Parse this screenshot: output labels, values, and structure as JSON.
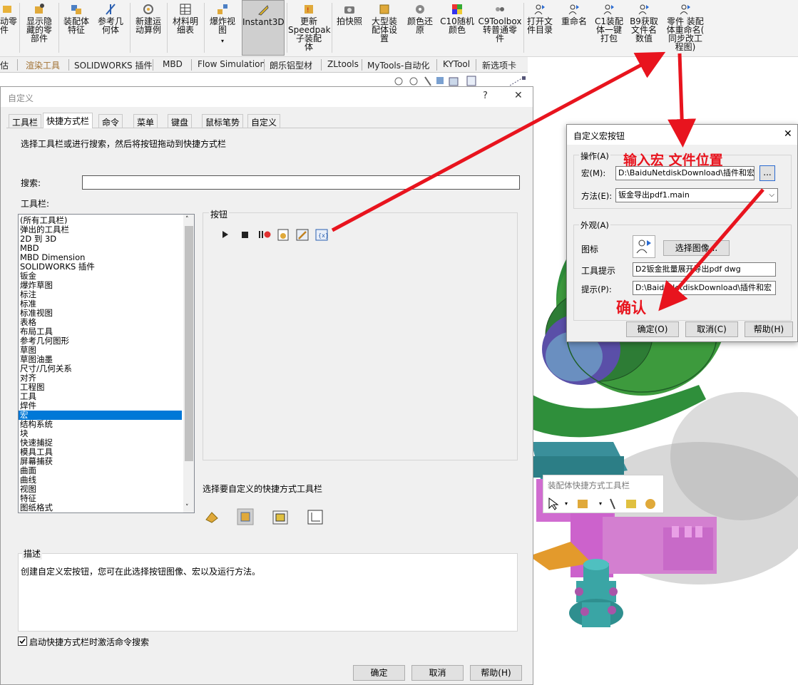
{
  "ribbon": {
    "items": [
      {
        "label": "动零\n件"
      },
      {
        "label": "显示隐\n藏的零\n部件"
      },
      {
        "label": "装配体\n特征"
      },
      {
        "label": "参考几\n何体"
      },
      {
        "label": "新建运\n动算例"
      },
      {
        "label": "材料明\n细表"
      },
      {
        "label": "爆炸视\n图"
      },
      {
        "label": "Instant3D"
      },
      {
        "label": "更新\nSpeedpak\n子装配\n体"
      },
      {
        "label": "拍快照"
      },
      {
        "label": "大型装\n配体设\n置"
      },
      {
        "label": "颜色还\n原"
      },
      {
        "label": "C10随机\n颜色"
      },
      {
        "label": "C9Toolbox\n转普通零\n件"
      },
      {
        "label": "打开文\n件目录"
      },
      {
        "label": "重命名"
      },
      {
        "label": "C1装配\n体一键\n打包"
      },
      {
        "label": "B9获取\n文件名\n数值"
      },
      {
        "label": "零件 装配\n体重命名(\n同步改工\n程图)"
      }
    ]
  },
  "cmdtabs": [
    "估",
    "渲染工具",
    "SOLIDWORKS 插件",
    "MBD",
    "Flow Simulation",
    "朗乐铝型材",
    "ZLtools",
    "MyTools-自动化",
    "KYTool",
    "新选项卡"
  ],
  "dialog": {
    "title": "自定义",
    "help": "?",
    "close": "✕",
    "tabs": [
      "工具栏",
      "快捷方式栏",
      "命令",
      "菜单",
      "键盘",
      "鼠标笔势",
      "自定义"
    ],
    "instruction": "选择工具栏或进行搜索，然后将按钮拖动到快捷方式栏",
    "search_label": "搜索:",
    "search_value": "",
    "toolbar_label": "工具栏:",
    "toolbars": [
      "(所有工具栏)",
      "弹出的工具栏",
      "2D 到 3D",
      "MBD",
      "MBD Dimension",
      "SOLIDWORKS 插件",
      "钣金",
      "爆炸草图",
      "标注",
      "标准",
      "标准视图",
      "表格",
      "布局工具",
      "参考几何图形",
      "草图",
      "草图油墨",
      "尺寸/几何关系",
      "对齐",
      "工程图",
      "工具",
      "焊件",
      "宏",
      "结构系统",
      "块",
      "快速捕捉",
      "模具工具",
      "屏幕捕获",
      "曲面",
      "曲线",
      "视图",
      "特征",
      "图纸格式"
    ],
    "selected_toolbar": "宏",
    "buttons_label": "按钮",
    "shortcut_label": "选择要自定义的快捷方式工具栏",
    "desc_label": "描述",
    "desc_text": "创建自定义宏按钮，您可在此选择按钮图像、宏以及运行方法。",
    "checkbox_label": "启动快捷方式栏时激活命令搜索",
    "checkbox_checked": true,
    "ok": "确定",
    "cancel": "取消",
    "help_btn": "帮助(H)"
  },
  "macro_dialog": {
    "title": "自定义宏按钮",
    "close": "✕",
    "action_group": "操作(A)",
    "macro_label": "宏(M):",
    "macro_value": "D:\\BaiduNetdiskDownload\\插件和宏",
    "browse": "...",
    "method_label": "方法(E):",
    "method_value": "钣金导出pdf1.main",
    "appearance_group": "外观(A)",
    "icon_label": "图标",
    "choose_image": "选择图像...",
    "tooltip_label": "工具提示",
    "tooltip_value": "D2钣金批量展开导出pdf dwg",
    "prompt_label": "提示(P):",
    "prompt_value": "D:\\BaiduNetdiskDownload\\插件和宏",
    "ok": "确定(O)",
    "cancel": "取消(C)",
    "help": "帮助(H)"
  },
  "annotations": {
    "input_macro": "输入宏 文件位置",
    "confirm": "确认"
  },
  "quick_toolbar": {
    "title": "装配体快捷方式工具栏"
  },
  "colors": {
    "selection": "#0078d7",
    "annotation_red": "#e8141e",
    "model_green": "#3d9a3d",
    "model_magenta": "#d65fd6",
    "model_teal": "#3fa6a6"
  }
}
